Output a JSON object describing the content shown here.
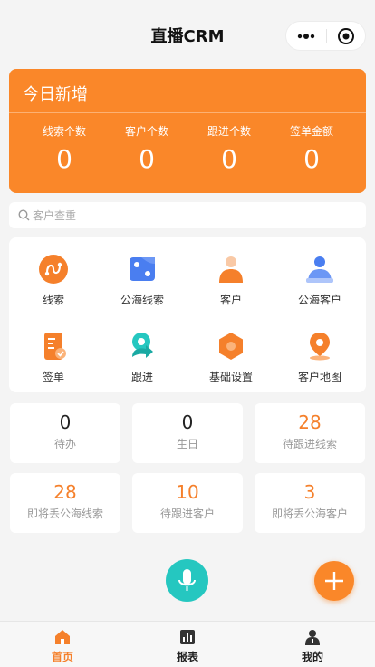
{
  "header": {
    "title": "直播CRM",
    "more_icon": "more-dots-icon",
    "close_icon": "target-close-icon"
  },
  "today_stats": {
    "title": "今日新增",
    "items": [
      {
        "label": "线索个数",
        "value": "0"
      },
      {
        "label": "客户个数",
        "value": "0"
      },
      {
        "label": "跟进个数",
        "value": "0"
      },
      {
        "label": "签单金额",
        "value": "0"
      }
    ]
  },
  "search": {
    "placeholder": "客户查重",
    "value": ""
  },
  "menu": [
    {
      "label": "线索",
      "icon": "lead-icon"
    },
    {
      "label": "公海线索",
      "icon": "public-lead-icon"
    },
    {
      "label": "客户",
      "icon": "customer-icon"
    },
    {
      "label": "公海客户",
      "icon": "public-customer-icon"
    },
    {
      "label": "签单",
      "icon": "contract-icon"
    },
    {
      "label": "跟进",
      "icon": "follow-up-icon"
    },
    {
      "label": "基础设置",
      "icon": "settings-icon"
    },
    {
      "label": "客户地图",
      "icon": "map-pin-icon"
    }
  ],
  "counts": [
    {
      "value": "0",
      "label": "待办"
    },
    {
      "value": "0",
      "label": "生日"
    },
    {
      "value": "28",
      "label": "待跟进线索"
    },
    {
      "value": "28",
      "label": "即将丢公海线索"
    },
    {
      "value": "10",
      "label": "待跟进客户"
    },
    {
      "value": "3",
      "label": "即将丢公海客户"
    }
  ],
  "tabs": [
    {
      "label": "首页",
      "icon": "home-icon",
      "active": true
    },
    {
      "label": "报表",
      "icon": "report-icon",
      "active": false
    },
    {
      "label": "我的",
      "icon": "profile-icon",
      "active": false
    }
  ],
  "colors": {
    "accent": "#fa8729",
    "teal": "#25c7c0",
    "blue": "#4a7ef0"
  }
}
